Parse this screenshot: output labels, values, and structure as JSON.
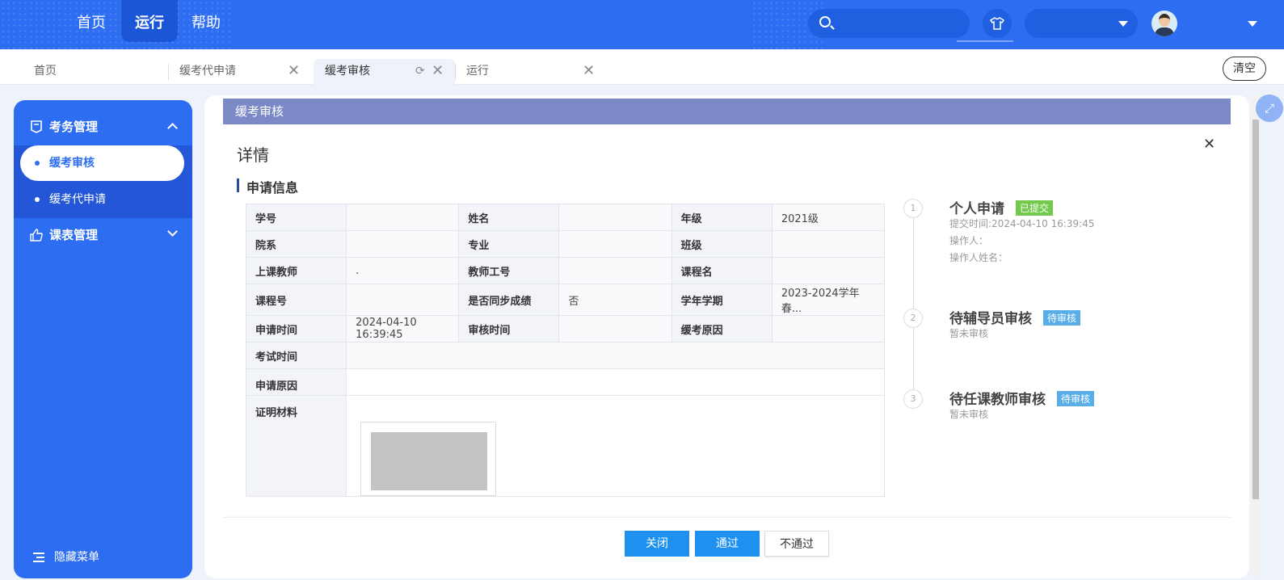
{
  "topnav": {
    "items": [
      {
        "label": "首页"
      },
      {
        "label": "运行"
      },
      {
        "label": "帮助"
      }
    ],
    "search_placeholder": "",
    "shirt_icon": "shirt-icon"
  },
  "tabs": [
    {
      "label": "首页"
    },
    {
      "label": "缓考代申请"
    },
    {
      "label": "缓考审核"
    },
    {
      "label": "运行"
    }
  ],
  "clear_label": "清空",
  "sidebar": {
    "groups": [
      {
        "label": "考务管理",
        "items": [
          {
            "label": "缓考审核"
          },
          {
            "label": "缓考代申请"
          }
        ]
      },
      {
        "label": "课表管理"
      }
    ],
    "hide_label": "隐藏菜单"
  },
  "panel": {
    "title": "缓考审核",
    "detail_title": "详情",
    "section_title": "申请信息",
    "rows": [
      [
        {
          "label": "学号",
          "value": ""
        },
        {
          "label": "姓名",
          "value": ""
        },
        {
          "label": "年级",
          "value": "2021级"
        }
      ],
      [
        {
          "label": "院系",
          "value": ""
        },
        {
          "label": "专业",
          "value": ""
        },
        {
          "label": "班级",
          "value": ""
        }
      ],
      [
        {
          "label": "上课教师",
          "value": "."
        },
        {
          "label": "教师工号",
          "value": ""
        },
        {
          "label": "课程名",
          "value": ""
        }
      ],
      [
        {
          "label": "课程号",
          "value": ""
        },
        {
          "label": "是否同步成绩",
          "value": "否"
        },
        {
          "label": "学年学期",
          "value": "2023-2024学年 春..."
        }
      ],
      [
        {
          "label": "申请时间",
          "value": "2024-04-10 16:39:45"
        },
        {
          "label": "审核时间",
          "value": ""
        },
        {
          "label": "缓考原因",
          "value": ""
        }
      ]
    ],
    "exam_time_label": "考试时间",
    "apply_reason_label": "申请原因",
    "proof_label": "证明材料"
  },
  "timeline": [
    {
      "num": "1",
      "title": "个人申请",
      "badge": "已提交",
      "meta": [
        "提交时间:2024-04-10 16:39:45",
        "操作人：",
        "操作人姓名："
      ]
    },
    {
      "num": "2",
      "title": "待辅导员审核",
      "badge": "待审核",
      "meta": [
        "暂未审核"
      ]
    },
    {
      "num": "3",
      "title": "待任课教师审核",
      "badge": "待审核",
      "meta": [
        "暂未审核"
      ]
    }
  ],
  "buttons": {
    "close": "关闭",
    "pass": "通过",
    "reject": "不通过"
  },
  "colors": {
    "topbar": "#2c6df2",
    "panel_title": "#7b89c7",
    "primary_button": "#1e90f0",
    "badge_green": "#73c94b",
    "badge_blue": "#5aaee8"
  }
}
